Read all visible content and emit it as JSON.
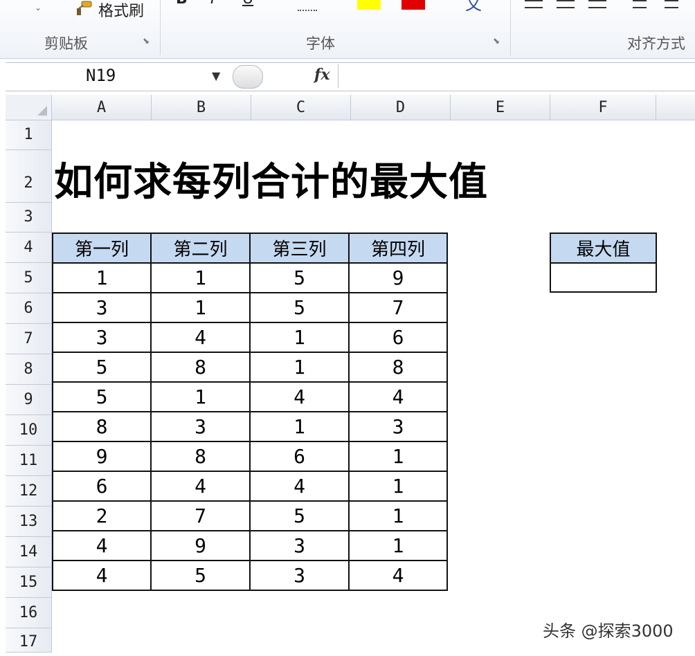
{
  "ribbon": {
    "clipboard": {
      "format_painter_label": "格式刷",
      "group_label": "剪贴板"
    },
    "font": {
      "bold": "B",
      "italic": "I",
      "underline": "U",
      "phonetic": "文",
      "group_label": "字体"
    },
    "alignment": {
      "group_label": "对齐方式"
    },
    "colors": {
      "highlight": "#ffff00",
      "font_color": "#e00000"
    }
  },
  "formula_bar": {
    "name_box": "N19",
    "fx_label": "fx",
    "formula": ""
  },
  "columns": [
    "A",
    "B",
    "C",
    "D",
    "E",
    "F"
  ],
  "rows": [
    "1",
    "2",
    "3",
    "4",
    "5",
    "6",
    "7",
    "8",
    "9",
    "10",
    "11",
    "12",
    "13",
    "14",
    "15",
    "16",
    "17"
  ],
  "sheet": {
    "title": "如何求每列合计的最大值",
    "table": {
      "headers": [
        "第一列",
        "第二列",
        "第三列",
        "第四列"
      ],
      "rows": [
        [
          "1",
          "1",
          "5",
          "9"
        ],
        [
          "3",
          "1",
          "5",
          "7"
        ],
        [
          "3",
          "4",
          "1",
          "6"
        ],
        [
          "5",
          "8",
          "1",
          "8"
        ],
        [
          "5",
          "1",
          "4",
          "4"
        ],
        [
          "8",
          "3",
          "1",
          "3"
        ],
        [
          "9",
          "8",
          "6",
          "1"
        ],
        [
          "6",
          "4",
          "4",
          "1"
        ],
        [
          "2",
          "7",
          "5",
          "1"
        ],
        [
          "4",
          "9",
          "3",
          "1"
        ],
        [
          "4",
          "5",
          "3",
          "4"
        ]
      ]
    },
    "max_box": {
      "header": "最大值",
      "value": ""
    }
  },
  "watermark": "头条 @探索3000",
  "theme": {
    "header_fill": "#c5d9f1",
    "grid_border": "#c2c9d4"
  }
}
